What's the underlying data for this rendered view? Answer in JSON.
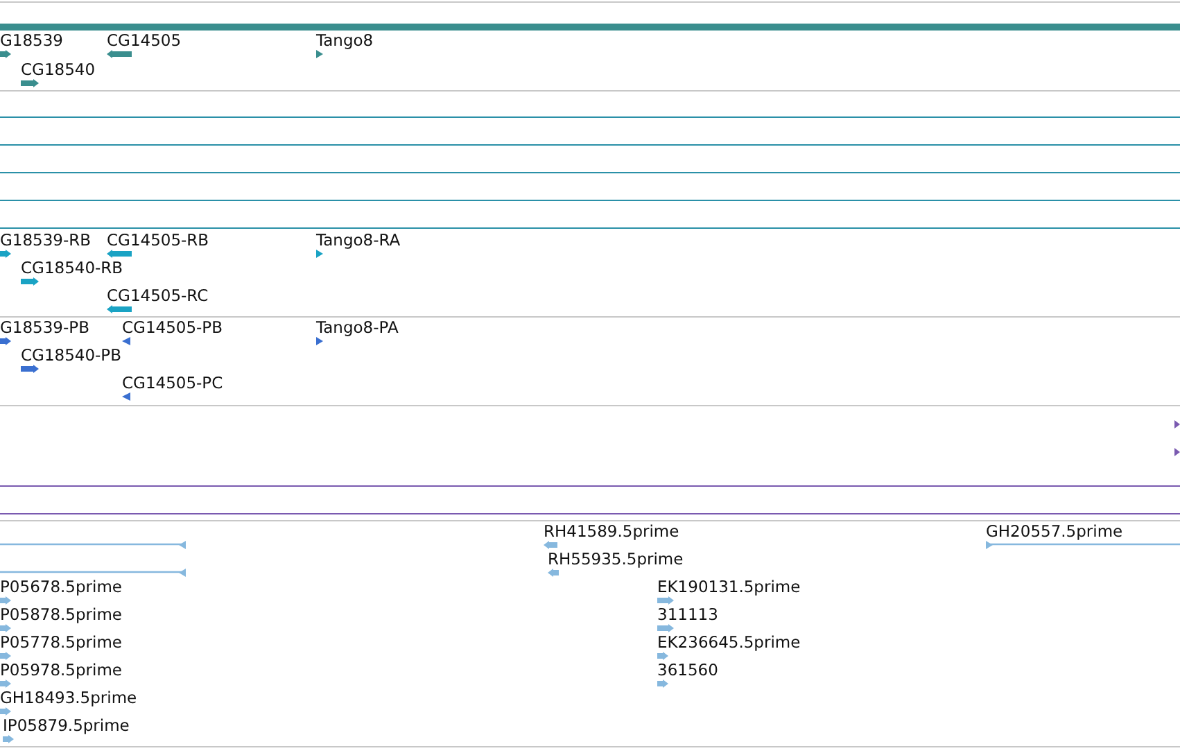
{
  "tracks": [
    {
      "color": "#3a8e8e",
      "features": [
        {
          "label": "G18539",
          "kind": "block",
          "reverse": false
        },
        {
          "label": "CG14505",
          "kind": "block",
          "reverse": true
        },
        {
          "label": "Tango8",
          "kind": "block",
          "reverse": false
        },
        {
          "label": "CG18540",
          "kind": "block",
          "reverse": false
        }
      ]
    },
    {
      "color": "#1aa3c4",
      "features": [
        {
          "label": "G18539-RB",
          "kind": "block",
          "reverse": false
        },
        {
          "label": "CG14505-RB",
          "kind": "block",
          "reverse": true
        },
        {
          "label": "Tango8-RA",
          "kind": "block",
          "reverse": false
        },
        {
          "label": "CG18540-RB",
          "kind": "block",
          "reverse": false
        },
        {
          "label": "CG14505-RC",
          "kind": "block",
          "reverse": true
        }
      ]
    },
    {
      "color": "#3a6fd0",
      "features": [
        {
          "label": "G18539-PB",
          "kind": "block",
          "reverse": false
        },
        {
          "label": "CG14505-PB",
          "kind": "block",
          "reverse": true
        },
        {
          "label": "Tango8-PA",
          "kind": "block",
          "reverse": false
        },
        {
          "label": "CG18540-PB",
          "kind": "block",
          "reverse": false
        },
        {
          "label": "CG14505-PC",
          "kind": "block",
          "reverse": true
        }
      ]
    },
    {
      "color": "#7a5ab0",
      "features": [
        {
          "kind": "block",
          "reverse": false
        },
        {
          "kind": "block",
          "reverse": false
        }
      ]
    },
    {
      "color": "#86b8de",
      "features": [
        {
          "kind": "span",
          "reverse": true
        },
        {
          "kind": "span",
          "reverse": true
        },
        {
          "label": "RH41589.5prime",
          "kind": "block",
          "reverse": true
        },
        {
          "label": "RH55935.5prime",
          "kind": "block",
          "reverse": true
        },
        {
          "label": "GH20557.5prime",
          "kind": "span",
          "reverse": false
        },
        {
          "label": "P05678.5prime",
          "kind": "block",
          "reverse": false
        },
        {
          "label": "EK190131.5prime",
          "kind": "block",
          "reverse": false
        },
        {
          "label": "P05878.5prime",
          "kind": "block",
          "reverse": false
        },
        {
          "label": "311113",
          "kind": "block",
          "reverse": false
        },
        {
          "label": "P05778.5prime",
          "kind": "block",
          "reverse": false
        },
        {
          "label": "EK236645.5prime",
          "kind": "block",
          "reverse": false
        },
        {
          "label": "P05978.5prime",
          "kind": "block",
          "reverse": false
        },
        {
          "label": "361560",
          "kind": "block",
          "reverse": false
        },
        {
          "label": "GH18493.5prime",
          "kind": "block",
          "reverse": false
        },
        {
          "label": "IP05879.5prime",
          "kind": "block",
          "reverse": false
        }
      ]
    }
  ]
}
